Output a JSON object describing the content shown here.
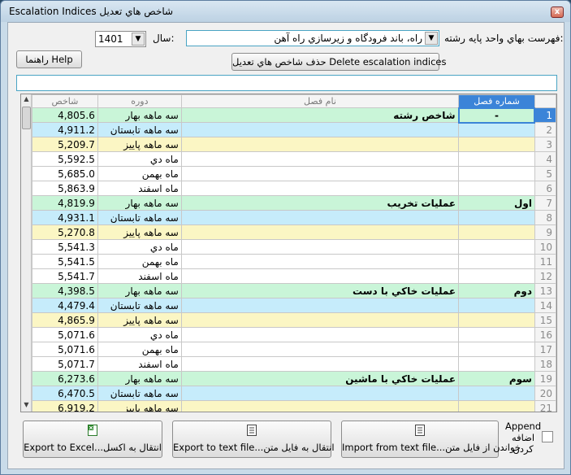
{
  "window": {
    "title": "Escalation Indices  شاخص هاي تعديل",
    "close": "x"
  },
  "form": {
    "list_label": "فهرست بهاي واحد پايه رشته:",
    "list_value": "راه، باند فرودگاه و زيرسازي راه آهن",
    "year_label": "سال:",
    "year_value": "1401",
    "help_button": "راهنما  Help",
    "delete_button": "حذف شاخص هاي تعديل   Delete escalation indices",
    "filter_value": ""
  },
  "grid": {
    "headers": {
      "chapter_no": "شماره فصل",
      "chapter_name": "نام فصل",
      "period": "دوره",
      "index": "شاخص"
    },
    "rows": [
      {
        "n": "1",
        "chap": "-",
        "name": "شاخص رشته",
        "per": "سه ماهه بهار",
        "val": "4,805.6",
        "c": "g"
      },
      {
        "n": "2",
        "chap": "",
        "name": "",
        "per": "سه ماهه تابستان",
        "val": "4,911.2",
        "c": "b"
      },
      {
        "n": "3",
        "chap": "",
        "name": "",
        "per": "سه ماهه پاييز",
        "val": "5,209.7",
        "c": "y"
      },
      {
        "n": "4",
        "chap": "",
        "name": "",
        "per": "ماه دي",
        "val": "5,592.5",
        "c": "w"
      },
      {
        "n": "5",
        "chap": "",
        "name": "",
        "per": "ماه بهمن",
        "val": "5,685.0",
        "c": "w"
      },
      {
        "n": "6",
        "chap": "",
        "name": "",
        "per": "ماه اسفند",
        "val": "5,863.9",
        "c": "w"
      },
      {
        "n": "7",
        "chap": "اول",
        "name": "عمليات تخريب",
        "per": "سه ماهه بهار",
        "val": "4,819.9",
        "c": "g"
      },
      {
        "n": "8",
        "chap": "",
        "name": "",
        "per": "سه ماهه تابستان",
        "val": "4,931.1",
        "c": "b"
      },
      {
        "n": "9",
        "chap": "",
        "name": "",
        "per": "سه ماهه پاييز",
        "val": "5,270.8",
        "c": "y"
      },
      {
        "n": "10",
        "chap": "",
        "name": "",
        "per": "ماه دي",
        "val": "5,541.3",
        "c": "w"
      },
      {
        "n": "11",
        "chap": "",
        "name": "",
        "per": "ماه بهمن",
        "val": "5,541.5",
        "c": "w"
      },
      {
        "n": "12",
        "chap": "",
        "name": "",
        "per": "ماه اسفند",
        "val": "5,541.7",
        "c": "w"
      },
      {
        "n": "13",
        "chap": "دوم",
        "name": "عمليات خاکي با دست",
        "per": "سه ماهه بهار",
        "val": "4,398.5",
        "c": "g"
      },
      {
        "n": "14",
        "chap": "",
        "name": "",
        "per": "سه ماهه تابستان",
        "val": "4,479.4",
        "c": "b"
      },
      {
        "n": "15",
        "chap": "",
        "name": "",
        "per": "سه ماهه پاييز",
        "val": "4,865.9",
        "c": "y"
      },
      {
        "n": "16",
        "chap": "",
        "name": "",
        "per": "ماه دي",
        "val": "5,071.6",
        "c": "w"
      },
      {
        "n": "17",
        "chap": "",
        "name": "",
        "per": "ماه بهمن",
        "val": "5,071.6",
        "c": "w"
      },
      {
        "n": "18",
        "chap": "",
        "name": "",
        "per": "ماه اسفند",
        "val": "5,071.7",
        "c": "w"
      },
      {
        "n": "19",
        "chap": "سوم",
        "name": "عمليات خاکي با ماشين",
        "per": "سه ماهه بهار",
        "val": "6,273.6",
        "c": "g"
      },
      {
        "n": "20",
        "chap": "",
        "name": "",
        "per": "سه ماهه تابستان",
        "val": "6,470.5",
        "c": "b"
      },
      {
        "n": "21",
        "chap": "",
        "name": "",
        "per": "سه ماهه پاييز",
        "val": "6,919.2",
        "c": "y"
      }
    ]
  },
  "footer": {
    "export_excel": "Export to Excel...انتقال به اکسل",
    "export_text": "Export to text file...انتقال به فايل متن",
    "import_text": "Import from text file...خواندن از فايل متن",
    "append_label": "Append\nاضافه\nکردن"
  }
}
